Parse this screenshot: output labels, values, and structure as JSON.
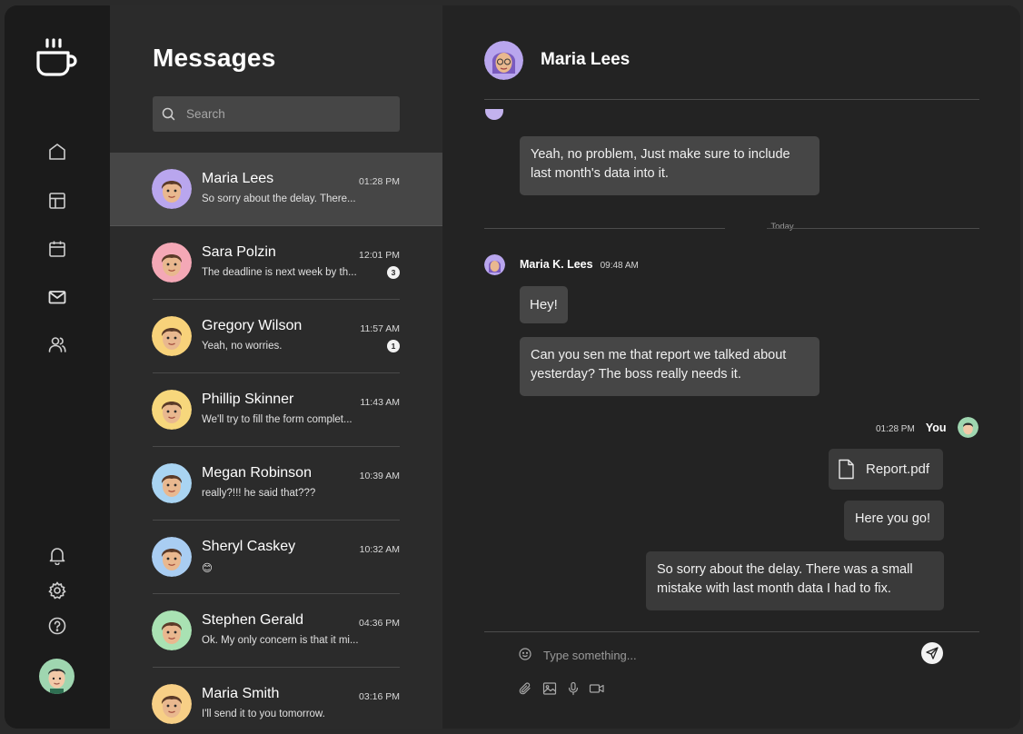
{
  "sidebar": {
    "logo_icon": "coffee-cup-icon",
    "nav": [
      "home-icon",
      "layout-icon",
      "calendar-icon",
      "mail-icon",
      "users-icon"
    ],
    "bottom": [
      "bell-icon",
      "gear-icon",
      "help-icon"
    ]
  },
  "list": {
    "title": "Messages",
    "search_placeholder": "Search",
    "conversations": [
      {
        "name": "Maria Lees",
        "time": "01:28 PM",
        "preview": "So sorry about the delay. There...",
        "badge": "",
        "avatar_color": "#b9a6ee",
        "active": true
      },
      {
        "name": "Sara Polzin",
        "time": "12:01 PM",
        "preview": "The deadline is next week by th...",
        "badge": "3",
        "avatar_color": "#f4a8b6",
        "active": false
      },
      {
        "name": "Gregory Wilson",
        "time": "11:57 AM",
        "preview": "Yeah, no worries.",
        "badge": "1",
        "avatar_color": "#f8d27a",
        "active": false
      },
      {
        "name": "Phillip Skinner",
        "time": "11:43 AM",
        "preview": "We'll try to fill the form complet...",
        "badge": "",
        "avatar_color": "#f7d77c",
        "active": false
      },
      {
        "name": "Megan Robinson",
        "time": "10:39 AM",
        "preview": "really?!!! he said that???",
        "badge": "",
        "avatar_color": "#a9d4f2",
        "active": false
      },
      {
        "name": "Sheryl Caskey",
        "time": "10:32 AM",
        "preview": "😊",
        "badge": "",
        "avatar_color": "#a9cdf2",
        "active": false
      },
      {
        "name": "Stephen Gerald",
        "time": "04:36 PM",
        "preview": "Ok. My only concern is that it mi...",
        "badge": "",
        "avatar_color": "#a9e2b3",
        "active": false
      },
      {
        "name": "Maria Smith",
        "time": "03:16 PM",
        "preview": "I'll send it to you tomorrow.",
        "badge": "",
        "avatar_color": "#f7cf86",
        "active": false
      }
    ]
  },
  "chat": {
    "contact_name": "Maria Lees",
    "messages": {
      "prev_reply": "Yeah, no problem, Just make sure to include last month's data into it.",
      "divider": "Today",
      "sender_name": "Maria K. Lees",
      "sender_time": "09:48 AM",
      "msg1": "Hey!",
      "msg2": "Can you sen me that report we talked about yesterday? The boss really needs it.",
      "my_time": "01:28 PM",
      "my_label": "You",
      "file_name": "Report.pdf",
      "reply1": "Here you go!",
      "reply2": "So sorry about the delay. There was a small mistake with last month data I had to fix."
    },
    "composer": {
      "placeholder": "Type something...",
      "tools": [
        "paperclip-icon",
        "image-icon",
        "microphone-icon",
        "video-icon"
      ]
    }
  },
  "colors": {
    "accent": "#464646",
    "background": "#232323",
    "sidebar": "#1b1b1b"
  }
}
